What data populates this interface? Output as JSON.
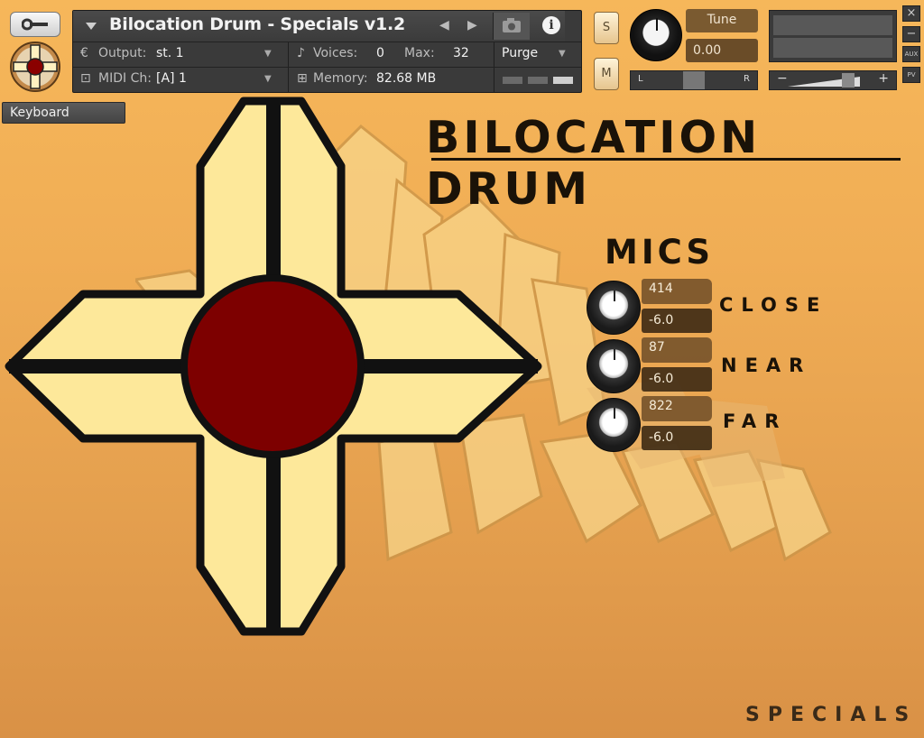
{
  "header": {
    "instrument_title": "Bilocation Drum - Specials v1.2",
    "output_label": "Output:",
    "output_value": "st. 1",
    "voices_label": "Voices:",
    "voices_value": "0",
    "max_label": "Max:",
    "max_value": "32",
    "purge_label": "Purge",
    "midi_label": "MIDI Ch:",
    "midi_value": "[A]  1",
    "memory_label": "Memory:",
    "memory_value": "82.68 MB",
    "solo_label": "S",
    "mute_label": "M",
    "tune_label": "Tune",
    "tune_value": "0.00",
    "pan_left": "L",
    "pan_right": "R",
    "vol_minus": "−",
    "vol_plus": "+",
    "aux_label": "AUX",
    "pv_label": "PV",
    "close_glyph": "×",
    "min_glyph": "−",
    "info_glyph": "i"
  },
  "keyboard_button": "Keyboard",
  "instrument": {
    "logo": "BILOCATION DRUM",
    "mics_title": "MICS",
    "mics": [
      {
        "name": "CLOSE",
        "position": "414",
        "volume": "-6.0"
      },
      {
        "name": "NEAR",
        "position": "87",
        "volume": "-6.0"
      },
      {
        "name": "FAR",
        "position": "822",
        "volume": "-6.0"
      }
    ],
    "footer": "SPECIALS"
  },
  "colors": {
    "background": "#f0ad55",
    "cross_fill": "#fde89a",
    "drum_red": "#7d0000",
    "outline": "#111111",
    "panel": "#3a3a3a"
  }
}
